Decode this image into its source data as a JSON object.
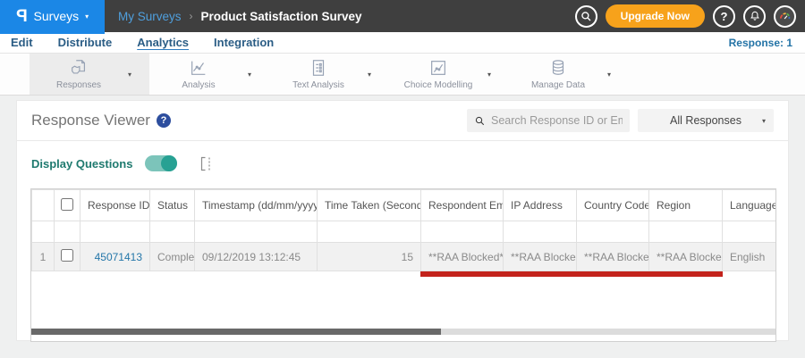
{
  "topbar": {
    "logo_glyph": "P",
    "product": "Surveys",
    "caret": "▾",
    "breadcrumb": {
      "parent": "My Surveys",
      "separator": "›",
      "current": "Product Satisfaction Survey"
    },
    "upgrade_label": "Upgrade Now",
    "help_glyph": "?"
  },
  "nav": {
    "tabs": [
      {
        "label": "Edit"
      },
      {
        "label": "Distribute"
      },
      {
        "label": "Analytics",
        "active": true
      },
      {
        "label": "Integration"
      }
    ],
    "response_count": "Response: 1"
  },
  "toolbar": {
    "caret": "▾",
    "items": [
      {
        "label": "Responses",
        "icon": "responses-icon",
        "active": true
      },
      {
        "label": "Analysis",
        "icon": "analysis-icon"
      },
      {
        "label": "Text Analysis",
        "icon": "text-analysis-icon"
      },
      {
        "label": "Choice Modelling",
        "icon": "choice-modelling-icon"
      },
      {
        "label": "Manage Data",
        "icon": "manage-data-icon"
      }
    ]
  },
  "viewer": {
    "title": "Response Viewer",
    "help_glyph": "?",
    "search_placeholder": "Search Response ID or Email",
    "search_value": "",
    "filter_value": "All Responses",
    "filter_caret": "▾",
    "display_questions": "Display Questions",
    "toggle_state": "on"
  },
  "table": {
    "headers": {
      "response_id": "Response ID",
      "status": "Status",
      "timestamp": "Timestamp (dd/mm/yyyy)",
      "time_taken": "Time Taken (Seconds)",
      "email": "Respondent Email",
      "ip": "IP Address",
      "country": "Country Code",
      "region": "Region",
      "language": "Language"
    },
    "sort_desc_glyph": "▼",
    "sort_both_glyph": "⇅",
    "rows": [
      {
        "index": "1",
        "response_id": "45071413",
        "status": "Completed",
        "timestamp": "09/12/2019 13:12:45",
        "time_taken": "15",
        "email": "**RAA Blocked**",
        "ip": "**RAA Blocked**",
        "country": "**RAA Blocked**",
        "region": "**RAA Blocked**",
        "language": "English"
      }
    ]
  },
  "colors": {
    "brand_blue": "#1b87e6",
    "topbar_bg": "#3f3f3f",
    "upgrade_orange": "#f7a21b",
    "nav_blue": "#2b5d85",
    "link_blue": "#2373a6",
    "teal_toggle": "#27a193",
    "annotation_red": "#c3231c"
  }
}
